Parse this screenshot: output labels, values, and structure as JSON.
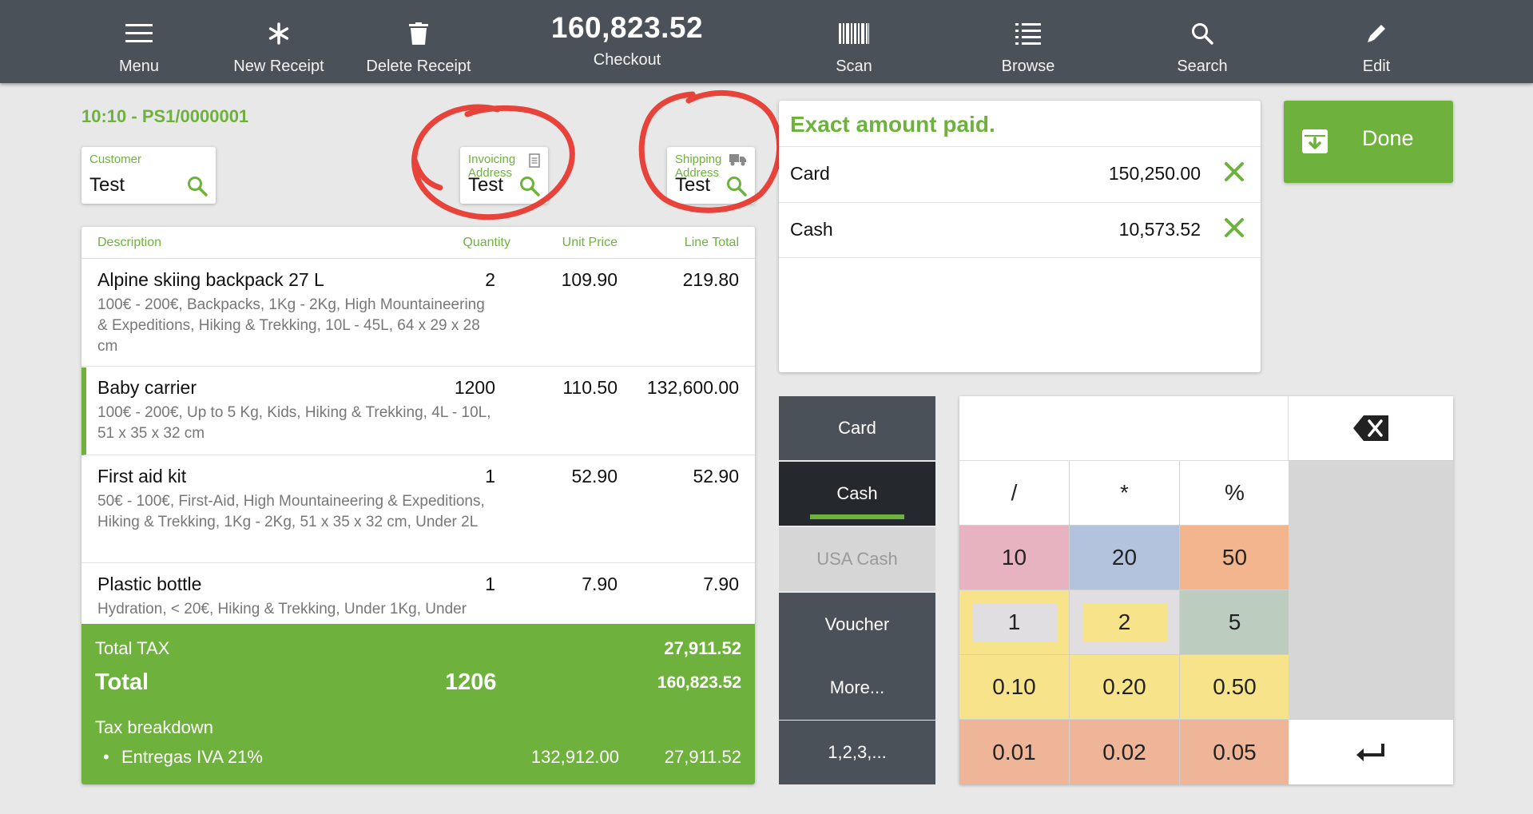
{
  "toolbar": {
    "menu_label": "Menu",
    "new_receipt_label": "New Receipt",
    "delete_receipt_label": "Delete Receipt",
    "checkout_amount": "160,823.52",
    "checkout_label": "Checkout",
    "scan_label": "Scan",
    "browse_label": "Browse",
    "search_label": "Search",
    "edit_label": "Edit"
  },
  "receipt": {
    "id": "10:10 - PS1/0000001",
    "customer": {
      "label": "Customer",
      "value": "Test"
    },
    "invoicing": {
      "label": "Invoicing Address",
      "value": "Test"
    },
    "shipping": {
      "label": "Shipping Address",
      "value": "Test"
    }
  },
  "lines": {
    "headers": {
      "description": "Description",
      "quantity": "Quantity",
      "unit_price": "Unit Price",
      "line_total": "Line Total"
    },
    "items": [
      {
        "name": "Alpine skiing backpack 27 L",
        "qty": "2",
        "price": "109.90",
        "total": "219.80",
        "attrs": "100€ - 200€, Backpacks, 1Kg - 2Kg, High Mountaineering & Expeditions, Hiking & Trekking, 10L - 45L, 64 x 29 x 28 cm"
      },
      {
        "name": "Baby carrier",
        "qty": "1200",
        "price": "110.50",
        "total": "132,600.00",
        "attrs": "100€ - 200€, Up to 5 Kg, Kids, Hiking & Trekking, 4L - 10L, 51 x 35 x 32 cm"
      },
      {
        "name": "First aid kit",
        "qty": "1",
        "price": "52.90",
        "total": "52.90",
        "attrs": "50€ - 100€, First-Aid, High Mountaineering & Expeditions, Hiking & Trekking, 1Kg - 2Kg, 51 x 35 x 32 cm, Under 2L"
      },
      {
        "name": "Plastic bottle",
        "qty": "1",
        "price": "7.90",
        "total": "7.90",
        "attrs": "Hydration, < 20€, Hiking & Trekking, Under 1Kg, Under"
      }
    ]
  },
  "totals": {
    "tax_label": "Total TAX",
    "tax_value": "27,911.52",
    "total_label": "Total",
    "total_qty": "1206",
    "total_value": "160,823.52",
    "breakdown_label": "Tax breakdown",
    "breakdown_bullet": "•",
    "breakdown_name": "Entregas IVA 21%",
    "breakdown_base": "132,912.00",
    "breakdown_tax": "27,911.52"
  },
  "payments": {
    "title": "Exact amount paid.",
    "items": [
      {
        "name": "Card",
        "amount": "150,250.00"
      },
      {
        "name": "Cash",
        "amount": "10,573.52"
      }
    ]
  },
  "done_label": "Done",
  "methods": [
    "Card",
    "Cash",
    "USA Cash",
    "Voucher",
    "More...",
    "1,2,3,..."
  ],
  "keypad": {
    "ops": [
      "/",
      "*",
      "%"
    ],
    "row_a": [
      "10",
      "20",
      "50"
    ],
    "row_b": [
      "1",
      "2",
      "5"
    ],
    "row_c": [
      "0.10",
      "0.20",
      "0.50"
    ],
    "row_d": [
      "0.01",
      "0.02",
      "0.05"
    ]
  },
  "colors": {
    "accent": "#6eb23d",
    "toolbar": "#4b5158",
    "key_pink": "#e7b3c0",
    "key_blue": "#b3c2dd",
    "key_orange": "#f3b58e",
    "key_yellow": "#f6e38a",
    "key_grey": "#e1dee1",
    "key_sage": "#bccdbf",
    "key_salmon": "#efb599",
    "annotation": "#e8433a"
  }
}
